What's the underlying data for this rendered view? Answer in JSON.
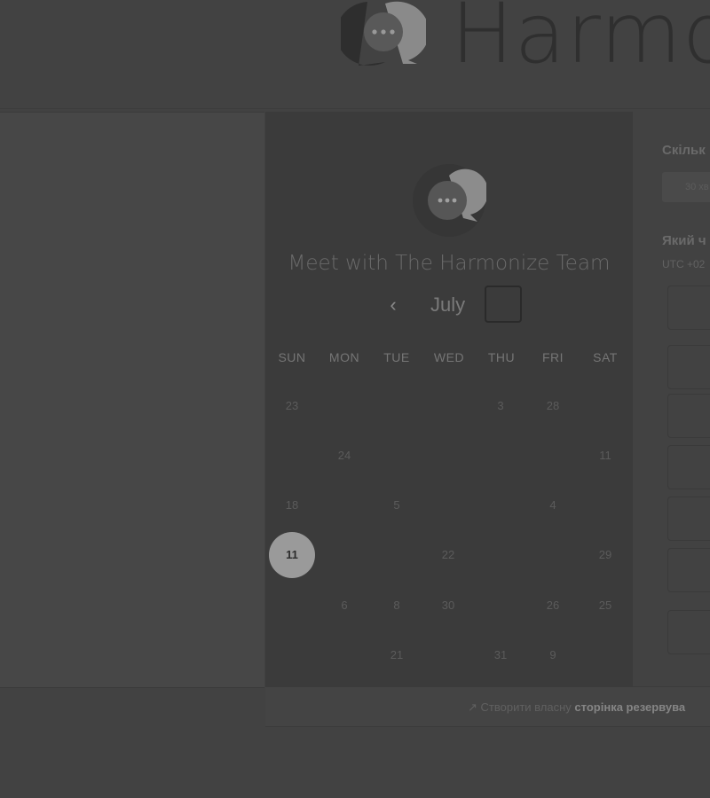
{
  "brand": {
    "name": "Harmo"
  },
  "calendar": {
    "title": "Meet with The Harmonize Team",
    "month": "July",
    "prev_label": "‹",
    "weekdays": [
      "SUN",
      "MON",
      "TUE",
      "WED",
      "THU",
      "FRI",
      "SAT"
    ],
    "days": [
      "23",
      "3",
      "28",
      "24",
      "11",
      "18",
      "5",
      "4",
      "11",
      "22",
      "29",
      "6",
      "8",
      "30",
      "26",
      "25",
      "21",
      "31",
      "9"
    ],
    "selected_day": "11"
  },
  "duration": {
    "label": "Скільк",
    "value": "30 хв"
  },
  "time": {
    "label": "Який ч",
    "timezone": "UTC +02"
  },
  "footer": {
    "icon": "arrow-icon",
    "text": "Створити власну",
    "strong": "сторінка резервува"
  },
  "colors": {
    "overlay": "#424242",
    "panel": "#3b3b3b",
    "selected": "#9a9a9a"
  }
}
